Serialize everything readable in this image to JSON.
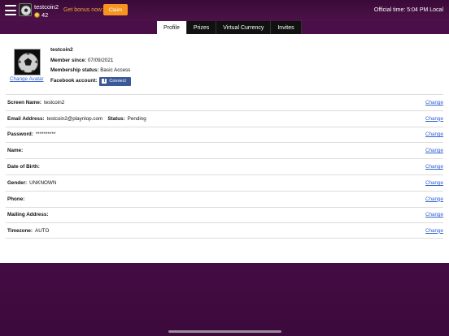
{
  "header": {
    "username": "testcoin2",
    "coins": "42",
    "bonus_text": "Get bonus now:",
    "claim_label": "Claim",
    "official_time": "Official time:  5:04 PM Local"
  },
  "tabs": [
    {
      "label": "Profile",
      "active": true
    },
    {
      "label": "Prizes",
      "active": false
    },
    {
      "label": "Virtual Currency",
      "active": false
    },
    {
      "label": "Invites",
      "active": false
    }
  ],
  "profile": {
    "username": "testcoin2",
    "member_since_label": "Member since:",
    "member_since": "07/09/2021",
    "membership_label": "Membership status:",
    "membership": "Basic Access",
    "facebook_label": "Facebook account:",
    "connect_label": "Connect",
    "change_avatar": "Change Avatar"
  },
  "fields": [
    {
      "label": "Screen Name:",
      "value": "testcoin2",
      "change": "Change"
    },
    {
      "label": "Email Address:",
      "value": "testcoin2@playnlop.com",
      "extra_label": "Status:",
      "extra_value": "Pending",
      "change": "Change"
    },
    {
      "label": "Password:",
      "value": "**********",
      "change": "Change"
    },
    {
      "label": "Name:",
      "value": "",
      "change": "Change"
    },
    {
      "label": "Date of Birth:",
      "value": "",
      "change": "Change"
    },
    {
      "label": "Gender:",
      "value": "UNKNOWN",
      "change": "Change"
    },
    {
      "label": "Phone:",
      "value": "",
      "change": "Change"
    },
    {
      "label": "Mailing Address:",
      "value": "",
      "change": "Change"
    },
    {
      "label": "Timezone:",
      "value": "AUTO",
      "change": "Change"
    }
  ],
  "colors": {
    "accent_orange": "#f7931e",
    "link_blue": "#2f5fd0",
    "facebook_blue": "#3b5998",
    "bg_purple": "#4a0f4a"
  }
}
